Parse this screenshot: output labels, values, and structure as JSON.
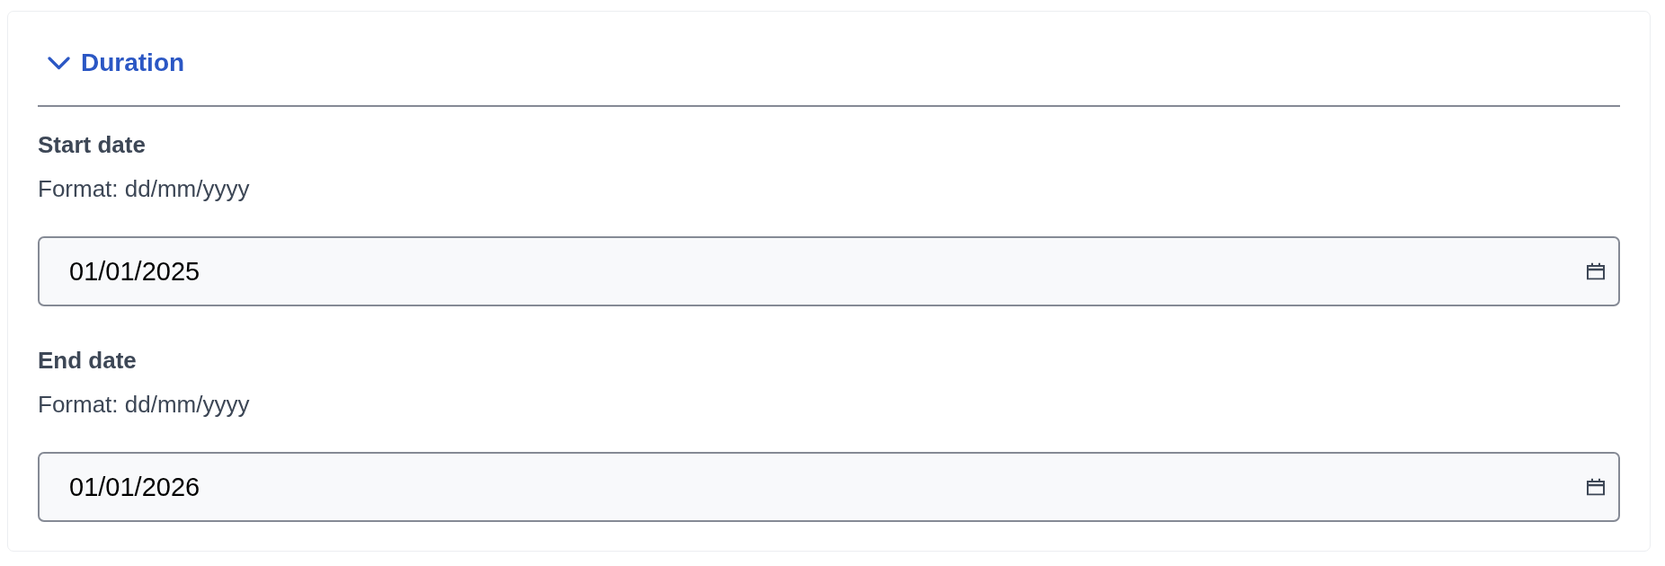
{
  "section": {
    "title": "Duration",
    "expanded": true
  },
  "fields": [
    {
      "label": "Start date",
      "hint": "Format: dd/mm/yyyy",
      "value": "01/01/2025"
    },
    {
      "label": "End date",
      "hint": "Format: dd/mm/yyyy",
      "value": "01/01/2026"
    }
  ]
}
